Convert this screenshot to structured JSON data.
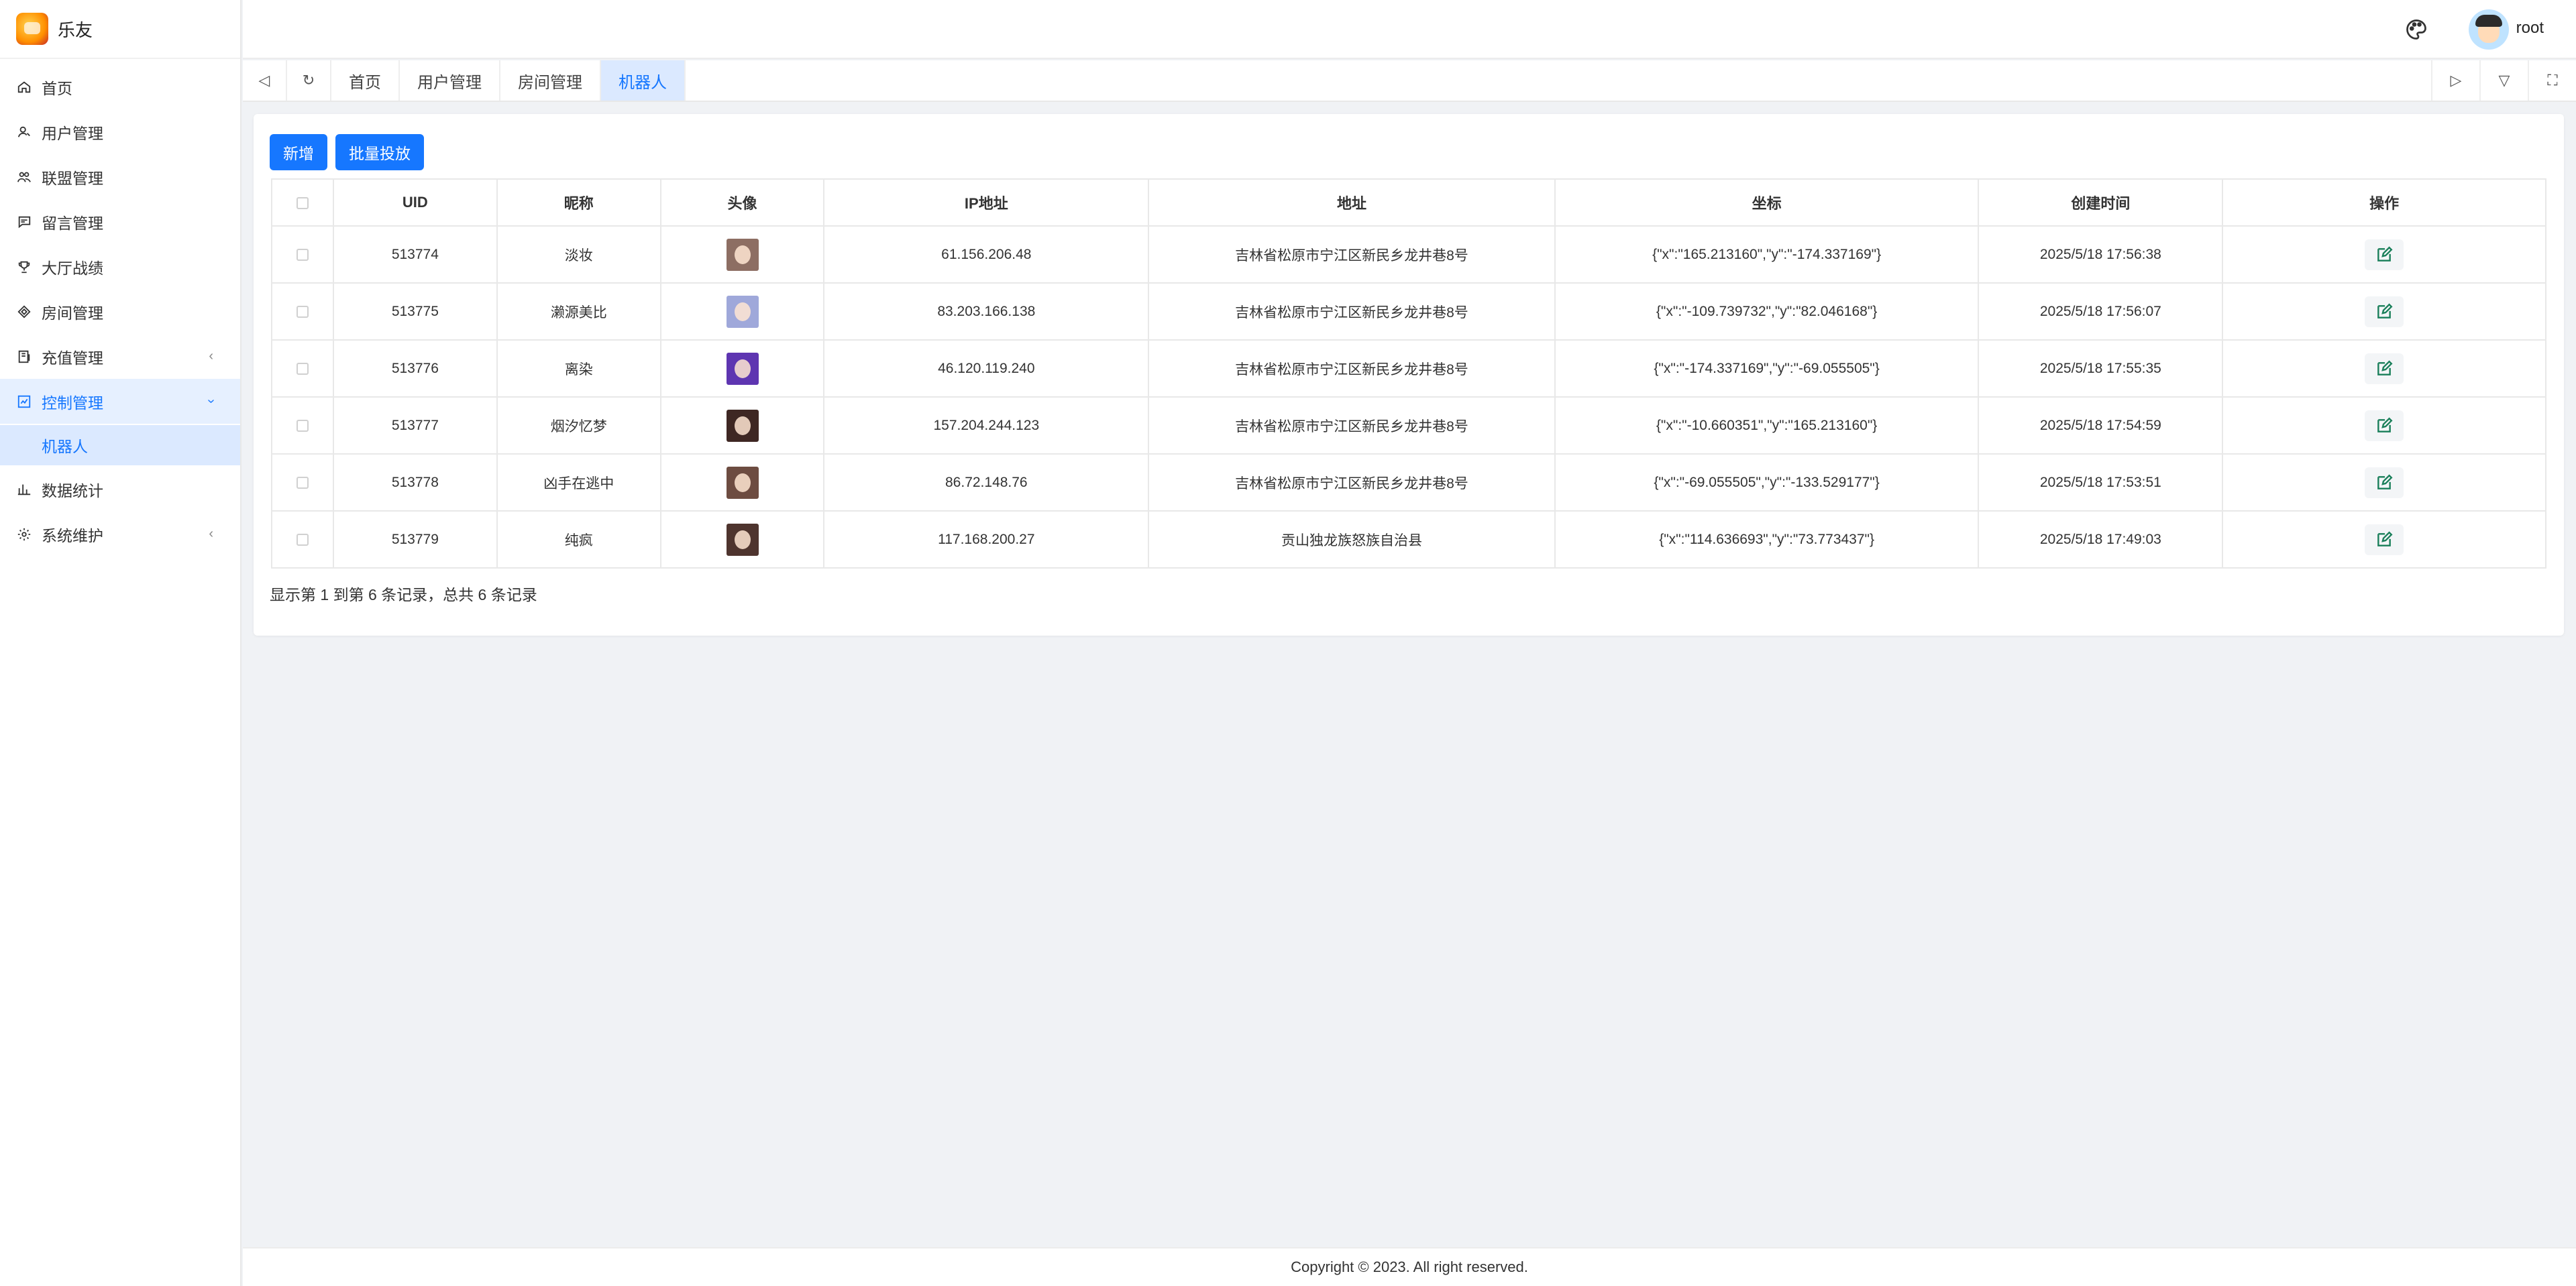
{
  "app": {
    "name": "乐友"
  },
  "header": {
    "username": "root"
  },
  "sidebar": {
    "items": [
      {
        "label": "首页",
        "icon": "home-icon"
      },
      {
        "label": "用户管理",
        "icon": "user-icon"
      },
      {
        "label": "联盟管理",
        "icon": "users-icon"
      },
      {
        "label": "留言管理",
        "icon": "message-icon"
      },
      {
        "label": "大厅战绩",
        "icon": "trophy-icon"
      },
      {
        "label": "房间管理",
        "icon": "room-icon"
      },
      {
        "label": "充值管理",
        "icon": "recharge-icon",
        "arrow": "‹"
      },
      {
        "label": "控制管理",
        "icon": "control-icon",
        "arrow": "›",
        "active": true
      },
      {
        "label": "数据统计",
        "icon": "chart-icon"
      },
      {
        "label": "系统维护",
        "icon": "settings-icon",
        "arrow": "‹"
      }
    ],
    "subitem": "机器人"
  },
  "tabs": [
    "首页",
    "用户管理",
    "房间管理",
    "机器人"
  ],
  "toolbar": {
    "add": "新增",
    "batch": "批量投放"
  },
  "table": {
    "headers": [
      "UID",
      "昵称",
      "头像",
      "IP地址",
      "地址",
      "坐标",
      "创建时间",
      "操作"
    ],
    "rows": [
      {
        "uid": "513774",
        "nick": "淡妆",
        "ip": "61.156.206.48",
        "addr": "吉林省松原市宁江区新民乡龙井巷8号",
        "coord": "{\"x\":\"165.213160\",\"y\":\"-174.337169\"}",
        "time": "2025/5/18 17:56:38",
        "avatar_color": "#8d6e63"
      },
      {
        "uid": "513775",
        "nick": "濑源美比",
        "ip": "83.203.166.138",
        "addr": "吉林省松原市宁江区新民乡龙井巷8号",
        "coord": "{\"x\":\"-109.739732\",\"y\":\"82.046168\"}",
        "time": "2025/5/18 17:56:07",
        "avatar_color": "#9fa8da"
      },
      {
        "uid": "513776",
        "nick": "离染",
        "ip": "46.120.119.240",
        "addr": "吉林省松原市宁江区新民乡龙井巷8号",
        "coord": "{\"x\":\"-174.337169\",\"y\":\"-69.055505\"}",
        "time": "2025/5/18 17:55:35",
        "avatar_color": "#5e35b1"
      },
      {
        "uid": "513777",
        "nick": "烟汐忆梦",
        "ip": "157.204.244.123",
        "addr": "吉林省松原市宁江区新民乡龙井巷8号",
        "coord": "{\"x\":\"-10.660351\",\"y\":\"165.213160\"}",
        "time": "2025/5/18 17:54:59",
        "avatar_color": "#3e2723"
      },
      {
        "uid": "513778",
        "nick": "凶手在逃中",
        "ip": "86.72.148.76",
        "addr": "吉林省松原市宁江区新民乡龙井巷8号",
        "coord": "{\"x\":\"-69.055505\",\"y\":\"-133.529177\"}",
        "time": "2025/5/18 17:53:51",
        "avatar_color": "#6d4c41"
      },
      {
        "uid": "513779",
        "nick": "纯疯",
        "ip": "117.168.200.27",
        "addr": "贡山独龙族怒族自治县",
        "coord": "{\"x\":\"114.636693\",\"y\":\"73.773437\"}",
        "time": "2025/5/18 17:49:03",
        "avatar_color": "#4e342e"
      }
    ]
  },
  "summary": "显示第 1 到第 6 条记录，总共 6 条记录",
  "footer": "Copyright © 2023. All right reserved.",
  "colors": {
    "primary": "#1677ff",
    "edit": "#1a7f5a"
  }
}
